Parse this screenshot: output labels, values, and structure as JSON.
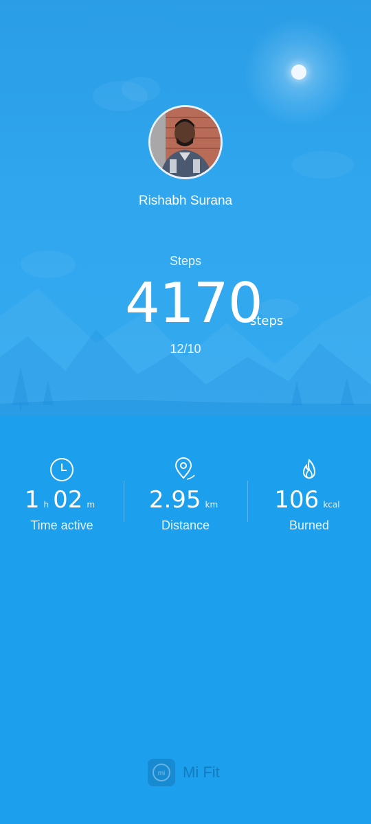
{
  "profile": {
    "name": "Rishabh Surana"
  },
  "steps": {
    "label": "Steps",
    "value": "4170",
    "unit": "steps",
    "date": "12/10"
  },
  "stats": [
    {
      "icon": "clock-icon",
      "hours": "1",
      "hours_unit": "h",
      "minutes": "02",
      "minutes_unit": "m",
      "label": "Time active"
    },
    {
      "icon": "location-pin-icon",
      "value": "2.95",
      "unit": "km",
      "label": "Distance"
    },
    {
      "icon": "flame-icon",
      "value": "106",
      "unit": "kcal",
      "label": "Burned"
    }
  ],
  "footer": {
    "brand": "Mi Fit"
  },
  "colors": {
    "background": "#1c9fec",
    "hero_top": "#2a9de6",
    "text": "#ffffff"
  }
}
